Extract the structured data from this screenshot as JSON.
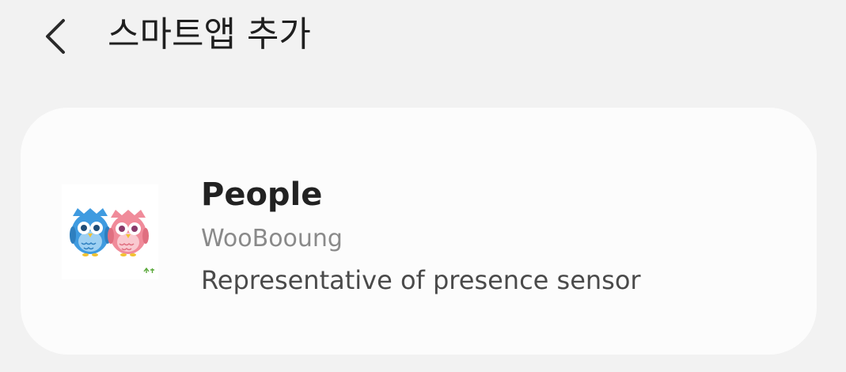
{
  "header": {
    "back_icon": "chevron-left-icon",
    "title": "스마트앱 추가"
  },
  "app_card": {
    "icon": "owls-app-icon",
    "name": "People",
    "developer": "WooBooung",
    "description": "Representative of presence sensor"
  },
  "colors": {
    "background": "#f2f2f2",
    "card": "#fcfcfc",
    "title_text": "#1f1f1f",
    "secondary_text": "#8a8a8a",
    "owl_blue": "#3f9be0",
    "owl_pink": "#f08b9a"
  }
}
